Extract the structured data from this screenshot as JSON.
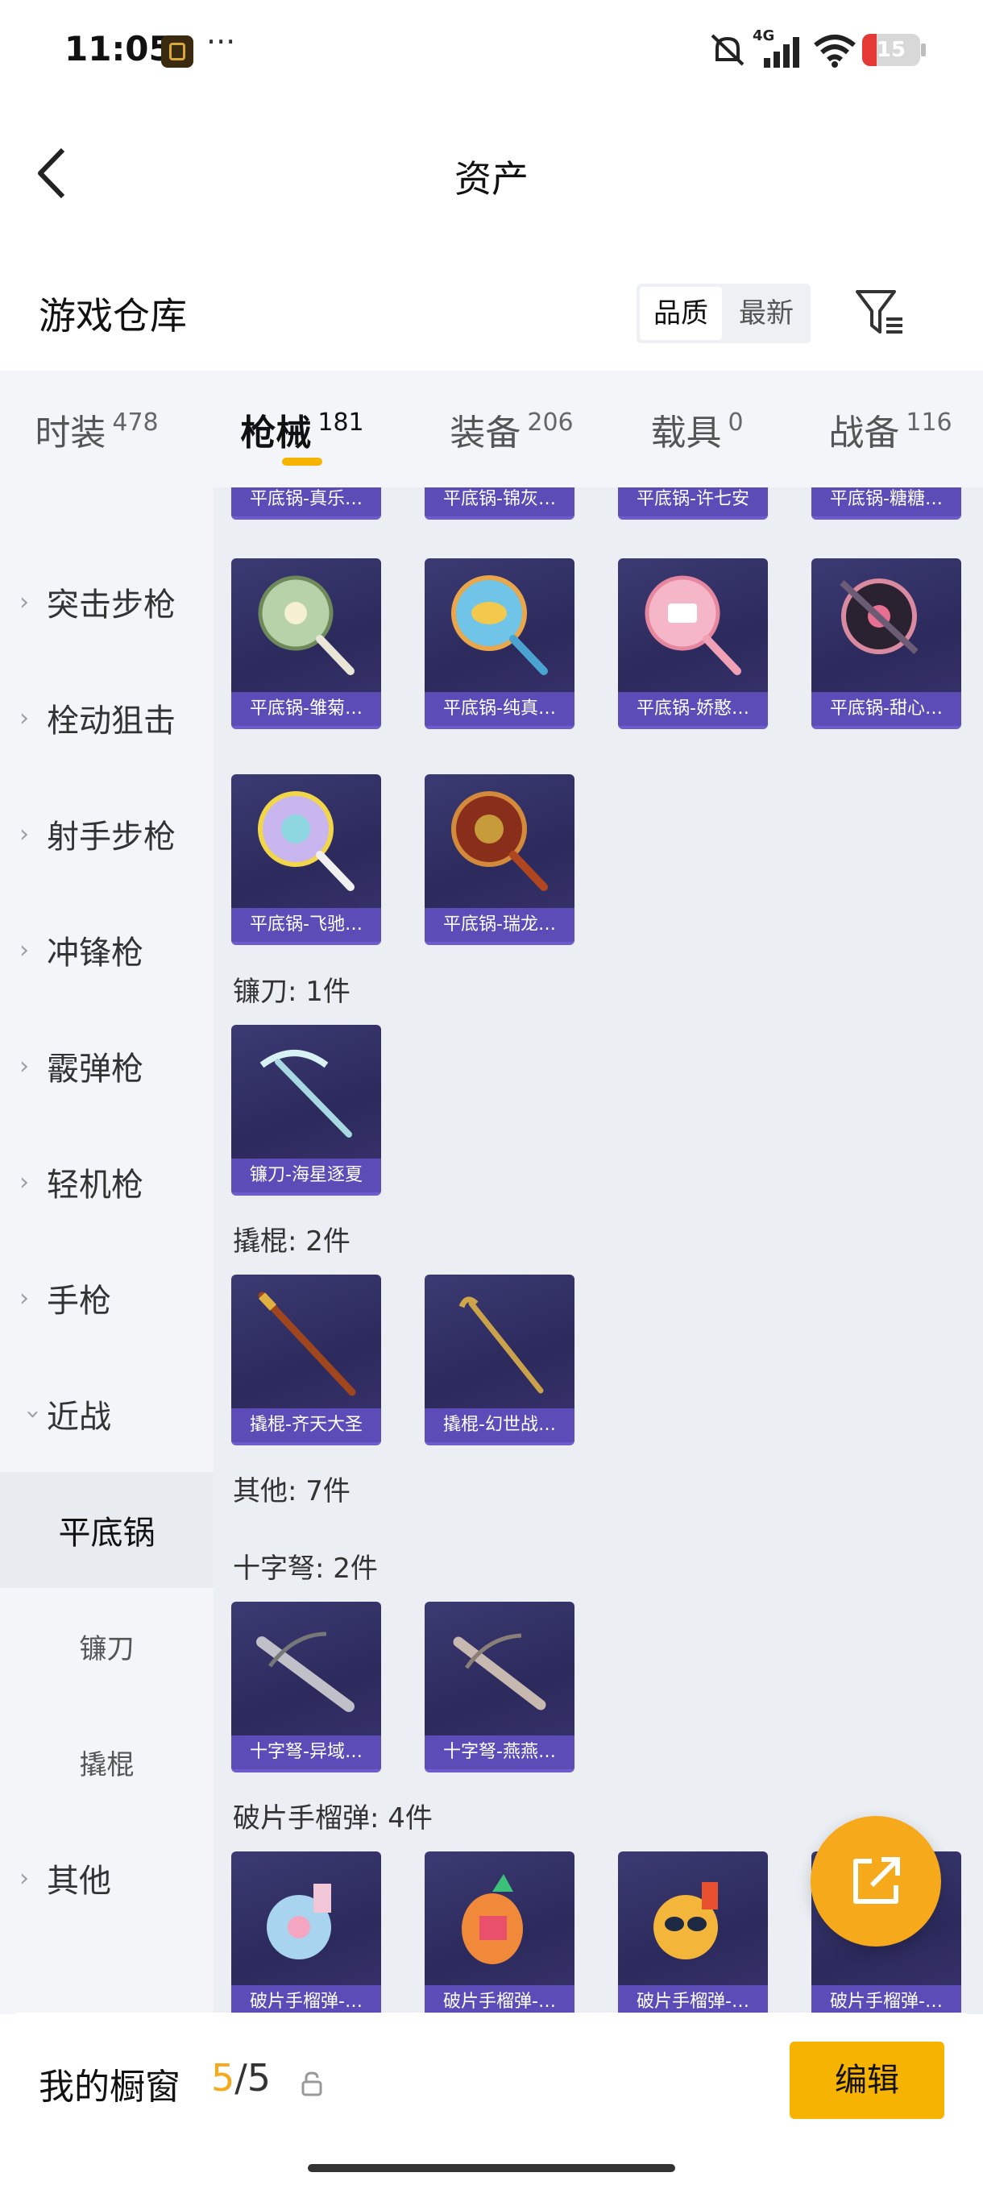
{
  "status_bar": {
    "time": "11:05",
    "dots": "···",
    "network": "4G",
    "battery": "15"
  },
  "nav": {
    "title": "资产"
  },
  "warehouse": {
    "title": "游戏仓库",
    "sort_quality": "品质",
    "sort_newest": "最新"
  },
  "tabs": [
    {
      "label": "时装",
      "count": "478"
    },
    {
      "label": "枪械",
      "count": "181"
    },
    {
      "label": "装备",
      "count": "206"
    },
    {
      "label": "载具",
      "count": "0"
    },
    {
      "label": "战备",
      "count": "116"
    }
  ],
  "sidebar": {
    "items": [
      "突击步枪",
      "栓动狙击",
      "射手步枪",
      "冲锋枪",
      "霰弹枪",
      "轻机枪",
      "手枪",
      "近战"
    ],
    "sub_items": [
      "平底锅",
      "镰刀",
      "撬棍"
    ],
    "last_item": "其他"
  },
  "content": {
    "top_partial": [
      "平底锅-真乐…",
      "平底锅-锦灰…",
      "平底锅-许七安",
      "平底锅-糖糖…"
    ],
    "pan_row1": [
      "平底锅-雏菊…",
      "平底锅-纯真…",
      "平底锅-娇憨…",
      "平底锅-甜心…"
    ],
    "pan_row2": [
      "平底锅-飞驰…",
      "平底锅-瑞龙…"
    ],
    "sickle_label": "镰刀: 1件",
    "sickle_items": [
      "镰刀-海星逐夏"
    ],
    "crowbar_label": "撬棍: 2件",
    "crowbar_items": [
      "撬棍-齐天大圣",
      "撬棍-幻世战…"
    ],
    "other_label": "其他: 7件",
    "crossbow_label": "十字弩: 2件",
    "crossbow_items": [
      "十字弩-异域…",
      "十字弩-燕燕…"
    ],
    "grenade_label": "破片手榴弹: 4件",
    "grenade_items": [
      "破片手榴弹-…",
      "破片手榴弹-…",
      "破片手榴弹-…",
      "破片手榴弹-…"
    ]
  },
  "bottom": {
    "title": "我的橱窗",
    "count_current": "5",
    "count_sep": "/5",
    "edit_label": "编辑"
  },
  "colors": {
    "accent": "#f6b400",
    "card_bg": "#2f2d62",
    "card_label": "#5b4cb8"
  }
}
